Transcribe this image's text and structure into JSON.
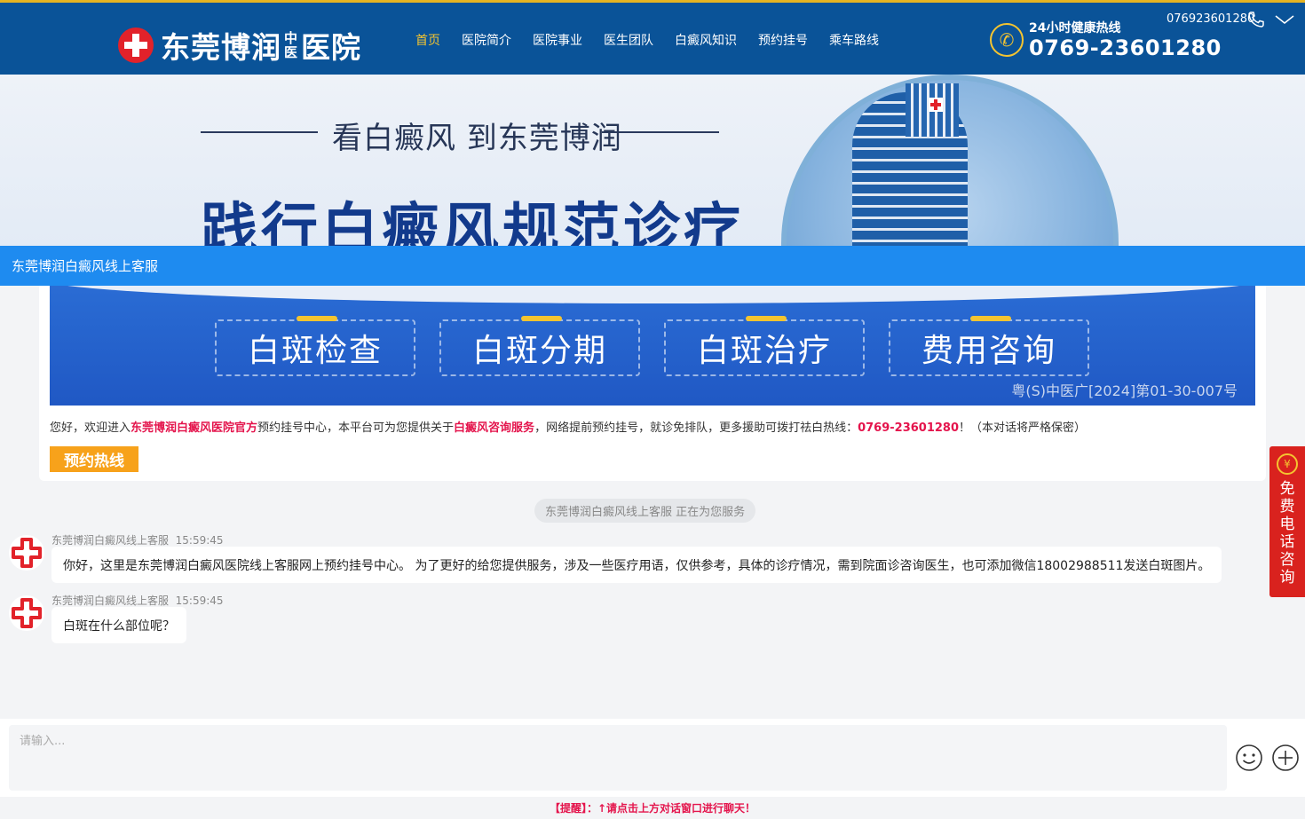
{
  "header": {
    "logo_main": "东莞博润",
    "logo_sub_top": "中",
    "logo_sub_bottom": "医",
    "logo_end": "医院",
    "nav": [
      "首页",
      "医院简介",
      "医院事业",
      "医生团队",
      "白癜风知识",
      "预约挂号",
      "乘车路线"
    ],
    "hotline_label": "24小时健康热线",
    "hotline_number": "0769-23601280",
    "accent_color": "#f4c430",
    "bg_color": "#0a5398"
  },
  "banner": {
    "subtitle": "看白癜风 到东莞博润",
    "title": "践行白癜风规范诊疗"
  },
  "chat_bar": {
    "title": "东莞博润白癜风线上客服",
    "phone": "076923601280",
    "color": "#1e8bf0"
  },
  "welcome": {
    "services": [
      "白斑检查",
      "白斑分期",
      "白斑治疗",
      "费用咨询"
    ],
    "license": "粤(S)中医广[2024]第01-30-007号",
    "text_1": "您好，欢迎进入",
    "text_hl_1": "东莞博润白癜风医院官方",
    "text_2": "预约挂号中心，本平台可为您提供关于",
    "text_hl_2": "白癜风咨询服务",
    "text_3": "，网络提前预约挂号，就诊免排队，更多援助可拨打祛白热线：",
    "text_hl_3": "0769-23601280",
    "text_4": "！（本对话将严格保密）",
    "hotline_btn": "预约热线"
  },
  "status": "东莞博润白癜风线上客服 正在为您服务",
  "messages": [
    {
      "sender": "东莞博润白癜风线上客服",
      "time": "15:59:45",
      "text": "你好，这里是东莞博润白癜风医院线上客服网上预约挂号中心。 为了更好的给您提供服务，涉及一些医疗用语，仅供参考，具体的诊疗情况，需到院面诊咨询医生，也可添加微信18002988511发送白斑图片。"
    },
    {
      "sender": "东莞博润白癜风线上客服",
      "time": "15:59:45",
      "text": "白斑在什么部位呢？"
    }
  ],
  "input": {
    "placeholder": "请输入..."
  },
  "reminder": "【提醒】：↑请点击上方对话窗口进行聊天！",
  "side_float": {
    "coin": "¥",
    "text": "免费电话咨询"
  }
}
